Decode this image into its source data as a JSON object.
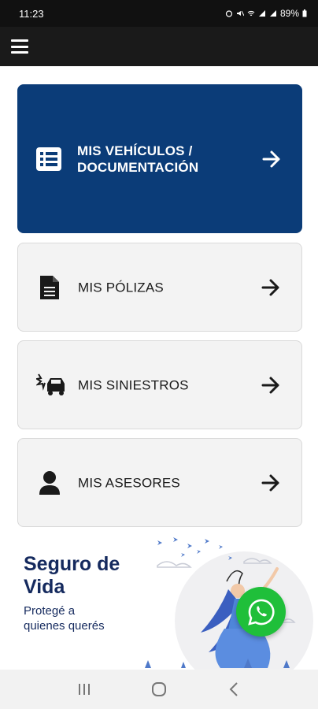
{
  "status_bar": {
    "time": "11:23",
    "battery": "89%"
  },
  "app_bar": {
    "menu_icon": "hamburger-menu-icon"
  },
  "menu": {
    "items": [
      {
        "label_line1": "MIS VEHÍCULOS /",
        "label_line2": "DOCUMENTACIÓN",
        "icon": "list-icon"
      },
      {
        "label": "MIS PÓLIZAS",
        "icon": "document-icon"
      },
      {
        "label": "MIS SINIESTROS",
        "icon": "car-crash-icon"
      },
      {
        "label": "MIS ASESORES",
        "icon": "user-icon"
      }
    ]
  },
  "banner": {
    "title_line1": "Seguro de",
    "title_line2": "Vida",
    "subtitle_line1": "Protegé a",
    "subtitle_line2": "quienes querés"
  },
  "colors": {
    "primary_card": "#0b3c78",
    "banner_text": "#152a5e",
    "whatsapp": "#1fbf3a"
  }
}
